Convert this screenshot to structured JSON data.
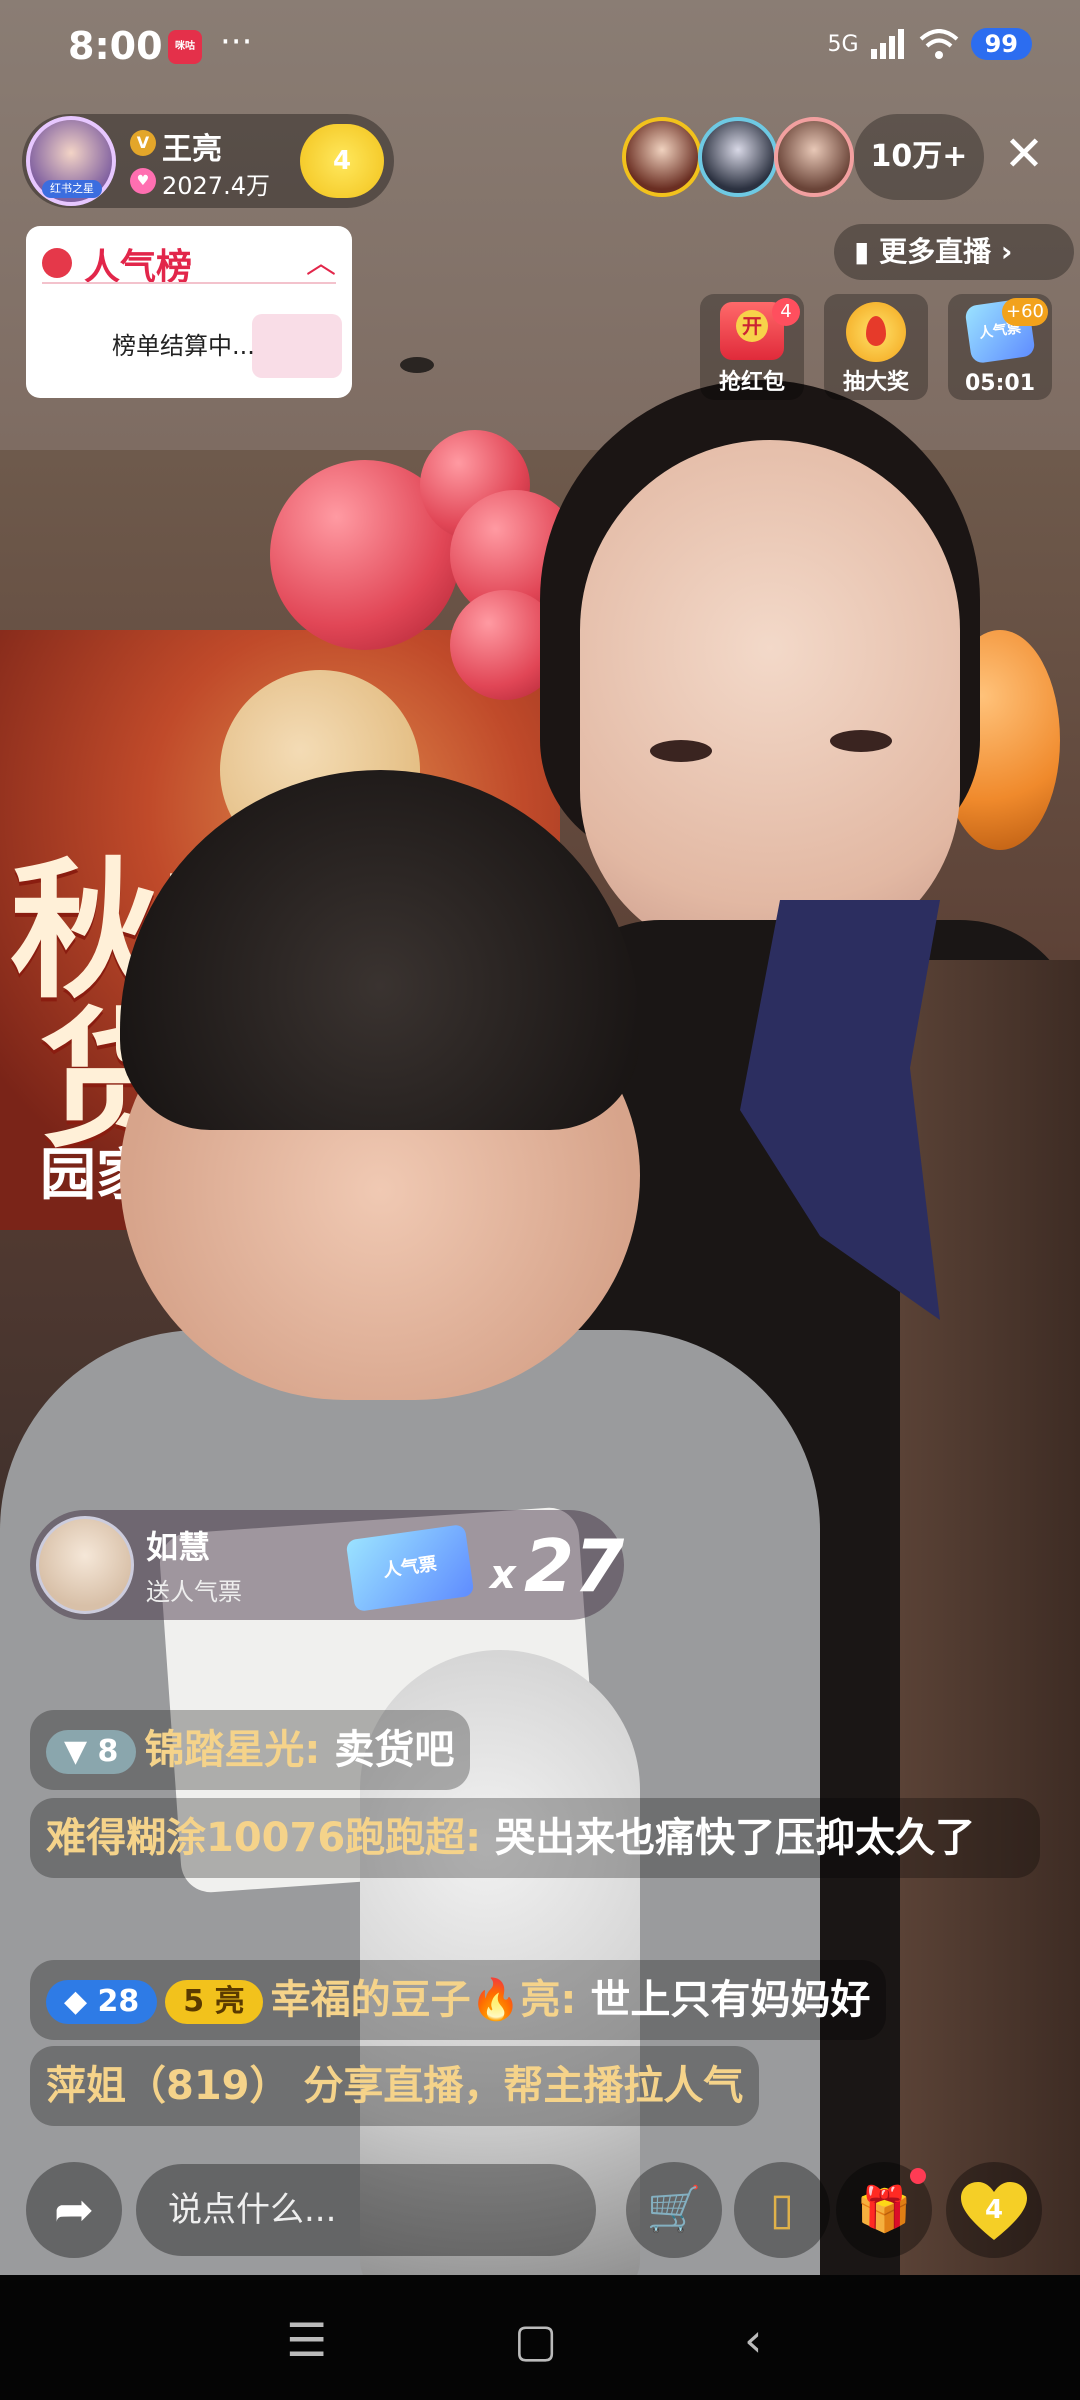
{
  "status_bar": {
    "time": "8:00",
    "app_badge": "咪咕",
    "more_dots": "···",
    "network": "5G",
    "battery": "99"
  },
  "host": {
    "name": "王亮",
    "avatar_tag": "红书之星",
    "v_badge": "V",
    "popularity": "2027.4万",
    "follow_count": "4"
  },
  "viewers": {
    "count": "10万+"
  },
  "rank_panel": {
    "title": "人气榜",
    "status": "榜单结算中..."
  },
  "more_live": {
    "label": "更多直播"
  },
  "activities": [
    {
      "label": "抢红包",
      "badge": "4",
      "icon_text": "开"
    },
    {
      "label": "抽大奖",
      "badge": "",
      "icon_text": ""
    },
    {
      "label": "05:01",
      "badge": "+60",
      "icon_text": "人气票"
    }
  ],
  "banner": {
    "line1": "秋宝",
    "line2": "货",
    "line3": "园家暖"
  },
  "gift_toast": {
    "user": "如慧",
    "action": "送人气票",
    "ticket_label": "人气票",
    "multiplier": "x",
    "quantity": "27"
  },
  "comments": [
    {
      "level": "8",
      "user": "锦踏星光:",
      "text": "卖货吧"
    },
    {
      "user": "难得糊涂10076跑跑超:",
      "text": "哭出来也痛快了压抑太久了"
    },
    {
      "level": "28",
      "fan_level": "5",
      "fan_name": "亮",
      "user": "幸福的豆子🔥亮:",
      "text": "世上只有妈妈好"
    },
    {
      "user": "萍姐（819）",
      "text": "分享直播，帮主播拉人气"
    }
  ],
  "bottom_bar": {
    "input_placeholder": "说点什么...",
    "like_count": "4"
  },
  "colors": {
    "accent_red": "#e2264a",
    "username_gold": "#f5d38a",
    "battery_blue": "#2c6df0"
  },
  "icons": [
    "share-icon",
    "cart-icon",
    "coupon-icon",
    "gift-icon",
    "heart-icon",
    "close-icon",
    "menu-icon",
    "home-icon",
    "back-icon"
  ]
}
